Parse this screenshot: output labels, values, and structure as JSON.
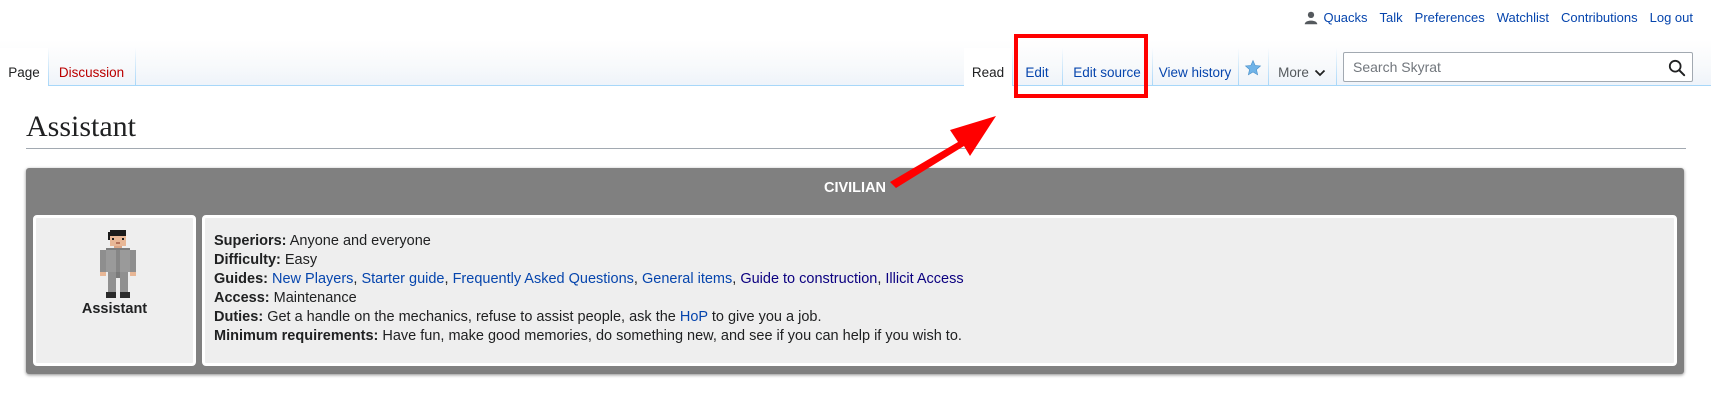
{
  "personal_tools": {
    "username": "Quacks",
    "talk": "Talk",
    "preferences": "Preferences",
    "watchlist": "Watchlist",
    "contributions": "Contributions",
    "logout": "Log out"
  },
  "tabs": {
    "page": "Page",
    "discussion": "Discussion",
    "read": "Read",
    "edit": "Edit",
    "edit_source": "Edit source",
    "view_history": "View history",
    "more": "More"
  },
  "search": {
    "placeholder": "Search Skyrat"
  },
  "icons": {
    "user": "user-icon",
    "watch": "star-icon",
    "more": "chevron-down-icon",
    "search": "magnifier-icon"
  },
  "colors": {
    "link": "#0645ad",
    "visited_link": "#0b0080",
    "new_link": "#ba0000",
    "infobox_header": "#808080",
    "annotation": "#ff0000"
  },
  "page": {
    "title": "Assistant"
  },
  "infobox": {
    "department": "CIVILIAN",
    "job_name": "Assistant",
    "superiors": {
      "label": "Superiors:",
      "value": "Anyone and everyone"
    },
    "difficulty": {
      "label": "Difficulty:",
      "value": "Easy"
    },
    "guides": {
      "label": "Guides:",
      "links": [
        {
          "text": "New Players",
          "sep": ", "
        },
        {
          "text": "Starter guide",
          "sep": ", "
        },
        {
          "text": "Frequently Asked Questions",
          "sep": ", "
        },
        {
          "text": "General items",
          "sep": ", "
        },
        {
          "text": "Guide to construction",
          "sep": ", "
        },
        {
          "text": "Illicit Access",
          "sep": ""
        }
      ]
    },
    "access": {
      "label": "Access:",
      "value": "Maintenance"
    },
    "duties": {
      "label": "Duties:",
      "before": "Get a handle on the mechanics, refuse to assist people, ask the ",
      "link": "HoP",
      "after": " to give you a job."
    },
    "min_requirements": {
      "label": "Minimum requirements:",
      "value": "Have fun, make good memories, do something new, and see if you can help if you wish to."
    }
  }
}
